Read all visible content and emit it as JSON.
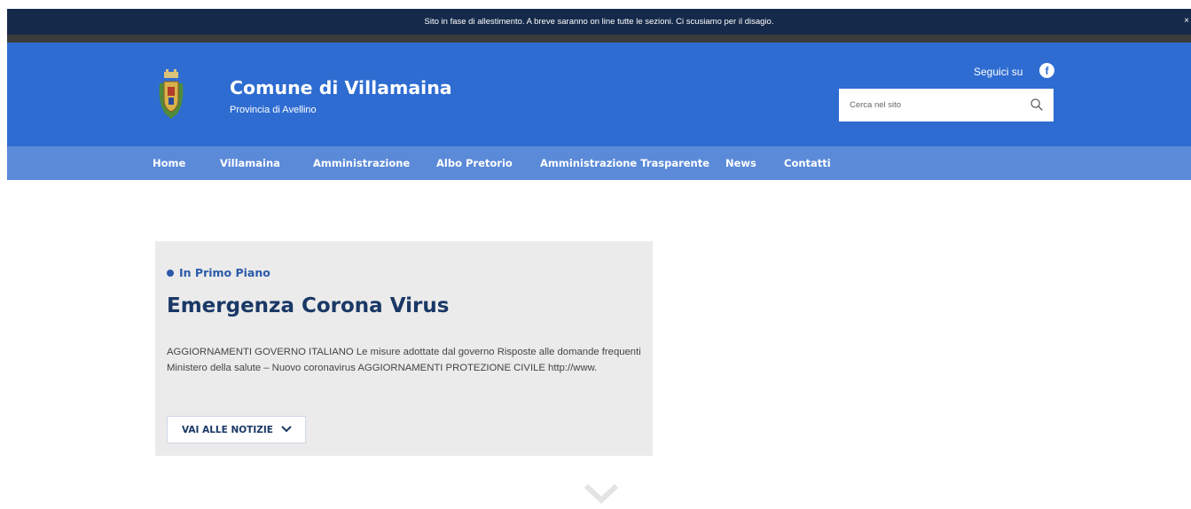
{
  "notice": {
    "text": "Sito in fase di allestimento. A breve saranno on line tutte le sezioni. Ci scusiamo per il disagio.",
    "close_label": "×"
  },
  "header": {
    "title": "Comune di Villamaina",
    "subtitle": "Provincia di Avellino",
    "follow_label": "Seguici su",
    "facebook_glyph": "f",
    "search_placeholder": "Cerca nel sito"
  },
  "nav": {
    "items": [
      {
        "label": "Home"
      },
      {
        "label": "Villamaina"
      },
      {
        "label": "Amministrazione"
      },
      {
        "label": "Albo Pretorio"
      },
      {
        "label": "Amministrazione Trasparente"
      },
      {
        "label": "News"
      },
      {
        "label": "Contatti"
      }
    ]
  },
  "featured": {
    "kicker": "In Primo Piano",
    "title": "Emergenza Corona Virus",
    "text": "AGGIORNAMENTI GOVERNO ITALIANO Le misure adottate dal governo Risposte alle domande frequenti Ministero della salute – Nuovo coronavirus AGGIORNAMENTI PROTEZIONE CIVILE http://www.",
    "button_label": "VAI ALLE NOTIZIE"
  },
  "colors": {
    "notice_bg": "#15294a",
    "header_bg": "#2e6cd1",
    "nav_bg": "#5b8ad8",
    "card_bg": "#ebebeb",
    "accent": "#1a3866"
  }
}
